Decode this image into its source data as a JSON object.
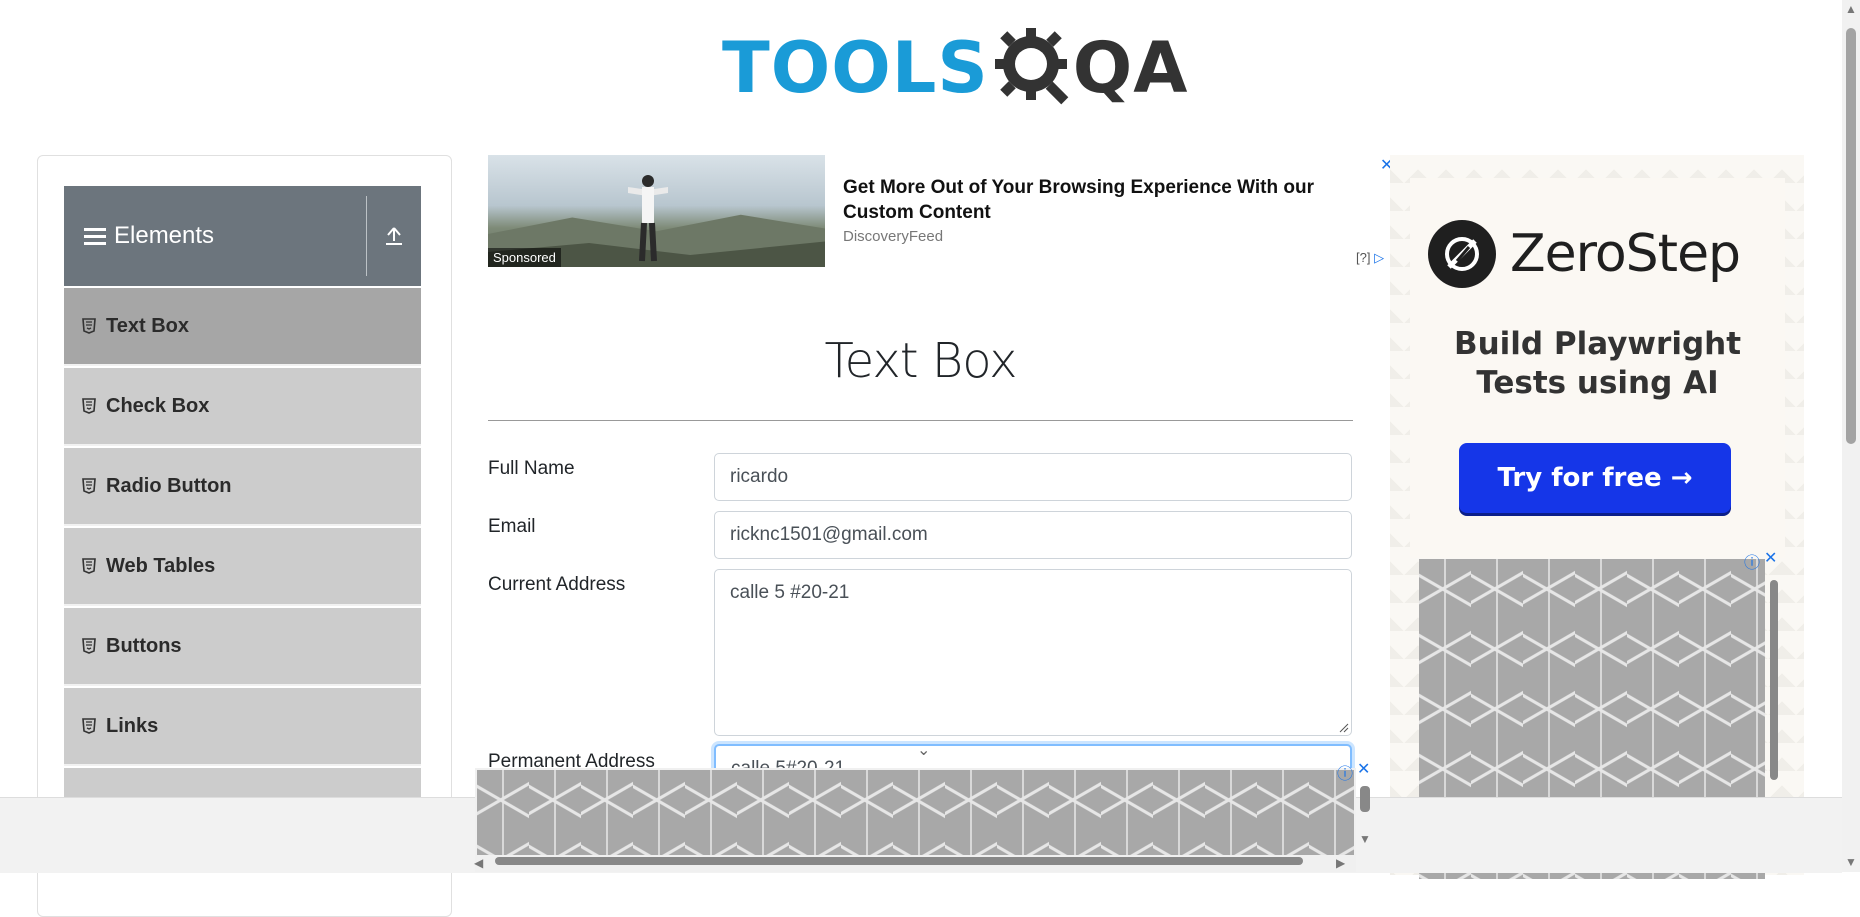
{
  "header": {
    "logo_text_tools": "TOOLS",
    "logo_text_qa": "QA"
  },
  "sidebar": {
    "group_title": "Elements",
    "items": [
      {
        "label": "Text Box",
        "active": true
      },
      {
        "label": "Check Box"
      },
      {
        "label": "Radio Button"
      },
      {
        "label": "Web Tables"
      },
      {
        "label": "Buttons"
      },
      {
        "label": "Links"
      }
    ]
  },
  "ad_top": {
    "sponsored": "Sponsored",
    "headline": "Get More Out of Your Browsing Experience With our Custom Content",
    "source": "DiscoveryFeed",
    "help": "[?]"
  },
  "form": {
    "title": "Text Box",
    "full_name_label": "Full Name",
    "full_name_value": "ricardo",
    "email_label": "Email",
    "email_value": "ricknc1501@gmail.com",
    "current_address_label": "Current Address",
    "current_address_value": "calle 5 #20-21",
    "permanent_address_label": "Permanent Address",
    "permanent_address_value": "calle 5#20-21"
  },
  "ad_right": {
    "brand": "ZeroStep",
    "tagline_line1": "Build Playwright",
    "tagline_line2": "Tests using AI",
    "cta": "Try for free →"
  },
  "colors": {
    "logo_blue": "#1a9bd7",
    "sidebar_header": "#6c757d",
    "menu_item": "#cccccc",
    "menu_active": "#a6a6a6",
    "cta_blue": "#1536e8"
  }
}
